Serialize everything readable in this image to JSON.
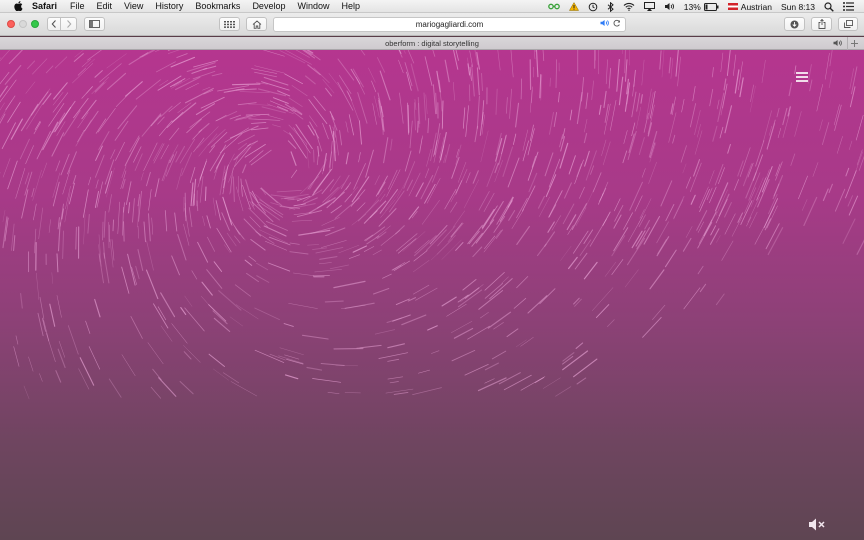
{
  "menubar": {
    "app_name": "Safari",
    "menus": [
      "File",
      "Edit",
      "View",
      "History",
      "Bookmarks",
      "Develop",
      "Window",
      "Help"
    ],
    "battery_percent": "13%",
    "input_source": "Austrian",
    "clock": "Sun 8:13"
  },
  "toolbar": {
    "url": "mariogagliardi.com"
  },
  "tab": {
    "title": "oberform : digital storytelling"
  },
  "colors": {
    "close": "#fc605c",
    "minimize": "#d9d9d9",
    "zoom": "#34c84a",
    "content_top": "#b5368f",
    "content_bottom": "#5e4552"
  }
}
